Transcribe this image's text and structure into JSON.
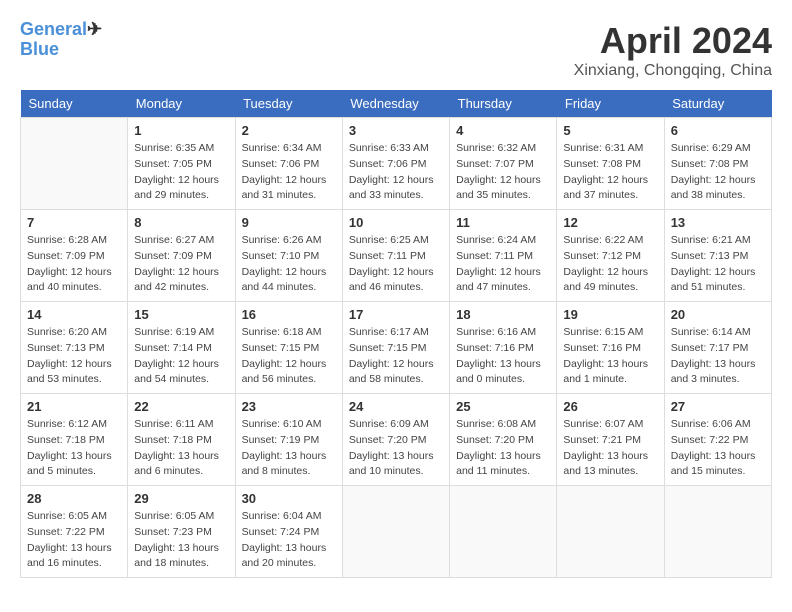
{
  "header": {
    "logo_line1": "General",
    "logo_line2": "Blue",
    "month": "April 2024",
    "location": "Xinxiang, Chongqing, China"
  },
  "weekdays": [
    "Sunday",
    "Monday",
    "Tuesday",
    "Wednesday",
    "Thursday",
    "Friday",
    "Saturday"
  ],
  "weeks": [
    [
      {
        "day": "",
        "info": ""
      },
      {
        "day": "1",
        "info": "Sunrise: 6:35 AM\nSunset: 7:05 PM\nDaylight: 12 hours\nand 29 minutes."
      },
      {
        "day": "2",
        "info": "Sunrise: 6:34 AM\nSunset: 7:06 PM\nDaylight: 12 hours\nand 31 minutes."
      },
      {
        "day": "3",
        "info": "Sunrise: 6:33 AM\nSunset: 7:06 PM\nDaylight: 12 hours\nand 33 minutes."
      },
      {
        "day": "4",
        "info": "Sunrise: 6:32 AM\nSunset: 7:07 PM\nDaylight: 12 hours\nand 35 minutes."
      },
      {
        "day": "5",
        "info": "Sunrise: 6:31 AM\nSunset: 7:08 PM\nDaylight: 12 hours\nand 37 minutes."
      },
      {
        "day": "6",
        "info": "Sunrise: 6:29 AM\nSunset: 7:08 PM\nDaylight: 12 hours\nand 38 minutes."
      }
    ],
    [
      {
        "day": "7",
        "info": "Sunrise: 6:28 AM\nSunset: 7:09 PM\nDaylight: 12 hours\nand 40 minutes."
      },
      {
        "day": "8",
        "info": "Sunrise: 6:27 AM\nSunset: 7:09 PM\nDaylight: 12 hours\nand 42 minutes."
      },
      {
        "day": "9",
        "info": "Sunrise: 6:26 AM\nSunset: 7:10 PM\nDaylight: 12 hours\nand 44 minutes."
      },
      {
        "day": "10",
        "info": "Sunrise: 6:25 AM\nSunset: 7:11 PM\nDaylight: 12 hours\nand 46 minutes."
      },
      {
        "day": "11",
        "info": "Sunrise: 6:24 AM\nSunset: 7:11 PM\nDaylight: 12 hours\nand 47 minutes."
      },
      {
        "day": "12",
        "info": "Sunrise: 6:22 AM\nSunset: 7:12 PM\nDaylight: 12 hours\nand 49 minutes."
      },
      {
        "day": "13",
        "info": "Sunrise: 6:21 AM\nSunset: 7:13 PM\nDaylight: 12 hours\nand 51 minutes."
      }
    ],
    [
      {
        "day": "14",
        "info": "Sunrise: 6:20 AM\nSunset: 7:13 PM\nDaylight: 12 hours\nand 53 minutes."
      },
      {
        "day": "15",
        "info": "Sunrise: 6:19 AM\nSunset: 7:14 PM\nDaylight: 12 hours\nand 54 minutes."
      },
      {
        "day": "16",
        "info": "Sunrise: 6:18 AM\nSunset: 7:15 PM\nDaylight: 12 hours\nand 56 minutes."
      },
      {
        "day": "17",
        "info": "Sunrise: 6:17 AM\nSunset: 7:15 PM\nDaylight: 12 hours\nand 58 minutes."
      },
      {
        "day": "18",
        "info": "Sunrise: 6:16 AM\nSunset: 7:16 PM\nDaylight: 13 hours\nand 0 minutes."
      },
      {
        "day": "19",
        "info": "Sunrise: 6:15 AM\nSunset: 7:16 PM\nDaylight: 13 hours\nand 1 minute."
      },
      {
        "day": "20",
        "info": "Sunrise: 6:14 AM\nSunset: 7:17 PM\nDaylight: 13 hours\nand 3 minutes."
      }
    ],
    [
      {
        "day": "21",
        "info": "Sunrise: 6:12 AM\nSunset: 7:18 PM\nDaylight: 13 hours\nand 5 minutes."
      },
      {
        "day": "22",
        "info": "Sunrise: 6:11 AM\nSunset: 7:18 PM\nDaylight: 13 hours\nand 6 minutes."
      },
      {
        "day": "23",
        "info": "Sunrise: 6:10 AM\nSunset: 7:19 PM\nDaylight: 13 hours\nand 8 minutes."
      },
      {
        "day": "24",
        "info": "Sunrise: 6:09 AM\nSunset: 7:20 PM\nDaylight: 13 hours\nand 10 minutes."
      },
      {
        "day": "25",
        "info": "Sunrise: 6:08 AM\nSunset: 7:20 PM\nDaylight: 13 hours\nand 11 minutes."
      },
      {
        "day": "26",
        "info": "Sunrise: 6:07 AM\nSunset: 7:21 PM\nDaylight: 13 hours\nand 13 minutes."
      },
      {
        "day": "27",
        "info": "Sunrise: 6:06 AM\nSunset: 7:22 PM\nDaylight: 13 hours\nand 15 minutes."
      }
    ],
    [
      {
        "day": "28",
        "info": "Sunrise: 6:05 AM\nSunset: 7:22 PM\nDaylight: 13 hours\nand 16 minutes."
      },
      {
        "day": "29",
        "info": "Sunrise: 6:05 AM\nSunset: 7:23 PM\nDaylight: 13 hours\nand 18 minutes."
      },
      {
        "day": "30",
        "info": "Sunrise: 6:04 AM\nSunset: 7:24 PM\nDaylight: 13 hours\nand 20 minutes."
      },
      {
        "day": "",
        "info": ""
      },
      {
        "day": "",
        "info": ""
      },
      {
        "day": "",
        "info": ""
      },
      {
        "day": "",
        "info": ""
      }
    ]
  ]
}
